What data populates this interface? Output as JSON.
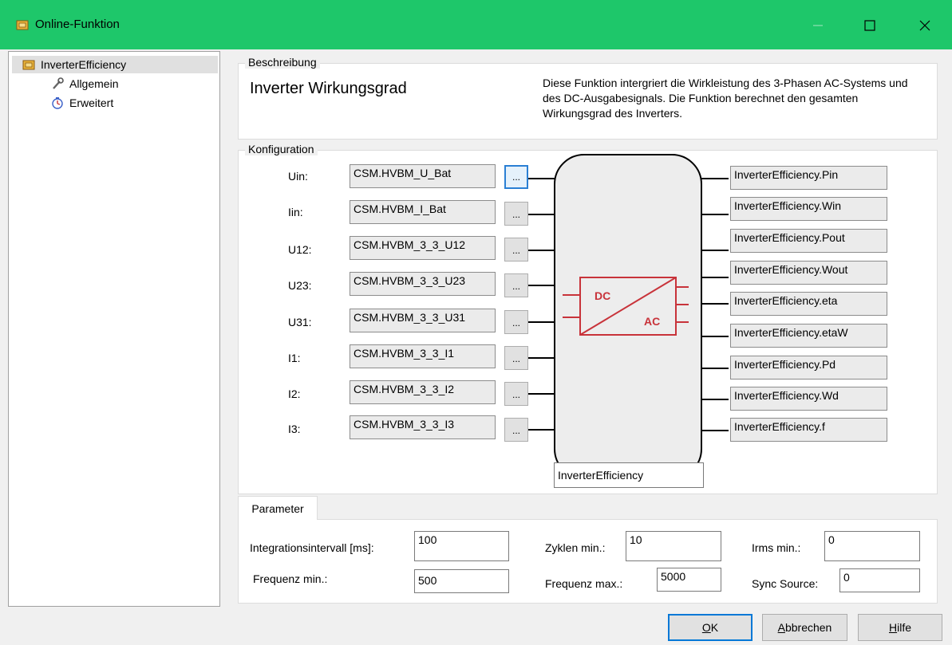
{
  "window": {
    "title": "Online-Funktion",
    "icon": "function-block-icon",
    "controls": [
      "minimize-icon",
      "maximize-icon",
      "close-icon"
    ]
  },
  "tree": {
    "root": {
      "label": "InverterEfficiency",
      "icon": "function-block-icon"
    },
    "children": [
      {
        "label": "Allgemein",
        "icon": "wrench-icon"
      },
      {
        "label": "Erweitert",
        "icon": "stopwatch-icon"
      }
    ]
  },
  "beschreibung": {
    "group_label": "Beschreibung",
    "heading": "Inverter Wirkungsgrad",
    "text": "Diese Funktion intergriert die Wirkleistung des 3-Phasen AC-Systems und des DC-Ausgabesignals. Die Funktion berechnet den gesamten Wirkungsgrad des Inverters."
  },
  "konfiguration": {
    "group_label": "Konfiguration",
    "inputs": [
      {
        "label": "Uin:",
        "value": "CSM.HVBM_U_Bat",
        "button": "..."
      },
      {
        "label": "Iin:",
        "value": "CSM.HVBM_I_Bat",
        "button": "..."
      },
      {
        "label": "U12:",
        "value": "CSM.HVBM_3_3_U12",
        "button": "..."
      },
      {
        "label": "U23:",
        "value": "CSM.HVBM_3_3_U23",
        "button": "..."
      },
      {
        "label": "U31:",
        "value": "CSM.HVBM_3_3_U31",
        "button": "..."
      },
      {
        "label": "I1:",
        "value": "CSM.HVBM_3_3_I1",
        "button": "..."
      },
      {
        "label": "I2:",
        "value": "CSM.HVBM_3_3_I2",
        "button": "..."
      },
      {
        "label": "I3:",
        "value": "CSM.HVBM_3_3_I3",
        "button": "..."
      }
    ],
    "outputs": [
      "InverterEfficiency.Pin",
      "InverterEfficiency.Win",
      "InverterEfficiency.Pout",
      "InverterEfficiency.Wout",
      "InverterEfficiency.eta",
      "InverterEfficiency.etaW",
      "InverterEfficiency.Pd",
      "InverterEfficiency.Wd",
      "InverterEfficiency.f"
    ],
    "block_name": "InverterEfficiency",
    "symbol": {
      "left_text": "DC",
      "right_text": "AC",
      "color": "#c8333a"
    }
  },
  "parameter": {
    "tab_label": "Parameter",
    "integrationsintervall": {
      "label": "Integrationsintervall [ms]:",
      "value": "100"
    },
    "zyklen_min": {
      "label": "Zyklen min.:",
      "value": "10"
    },
    "irms_min": {
      "label": "Irms min.:",
      "value": "0"
    },
    "frequenz_min": {
      "label": "Frequenz min.:",
      "value": "500"
    },
    "frequenz_max": {
      "label": "Frequenz max.:",
      "value": "5000"
    },
    "sync_source": {
      "label": "Sync Source:",
      "value": "0"
    }
  },
  "buttons": {
    "ok": "OK",
    "cancel": "Abbrechen",
    "help": "Hilfe"
  },
  "colors": {
    "titlebar": "#1ec76a",
    "focus": "#0078d7"
  }
}
